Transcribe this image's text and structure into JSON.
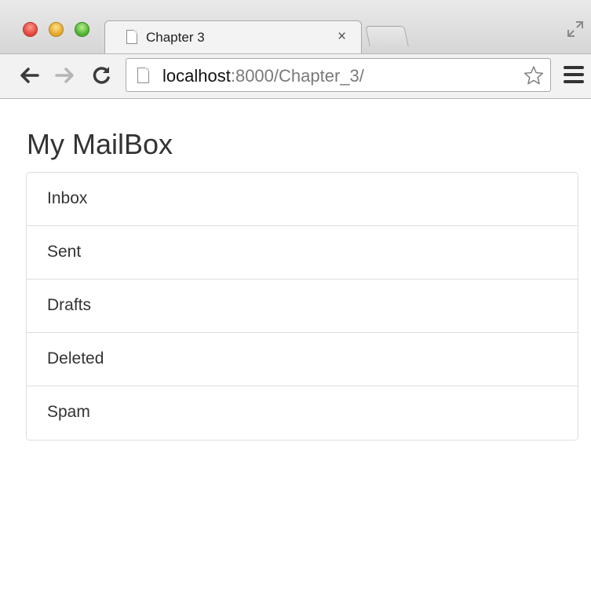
{
  "browser": {
    "tab_title": "Chapter 3",
    "tab_close": "×",
    "url_host": "localhost",
    "url_rest": ":8000/Chapter_3/"
  },
  "page": {
    "heading": "My MailBox",
    "folders": [
      {
        "label": "Inbox"
      },
      {
        "label": "Sent"
      },
      {
        "label": "Drafts"
      },
      {
        "label": "Deleted"
      },
      {
        "label": "Spam"
      }
    ]
  },
  "icons": {
    "back": "back-arrow-icon",
    "forward": "forward-arrow-icon",
    "reload": "reload-icon",
    "bookmark": "star-icon",
    "menu": "hamburger-menu-icon",
    "fullscreen": "fullscreen-icon",
    "page": "page-icon"
  },
  "colors": {
    "close": "#e0443a",
    "minimize": "#e3a52a",
    "zoom": "#4fb131",
    "text": "#333333",
    "border": "#dddddd"
  }
}
